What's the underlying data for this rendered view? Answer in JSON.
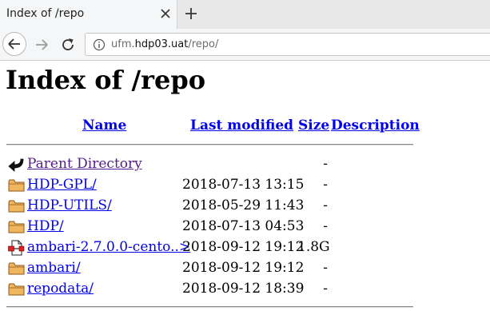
{
  "browser": {
    "tab_title": "Index of /repo",
    "url_prefix": "ufm.",
    "url_host": "hdp03.uat",
    "url_path": "/repo/"
  },
  "page": {
    "title": "Index of /repo",
    "columns": {
      "name": "Name",
      "last_modified": "Last modified",
      "size": "Size",
      "description": "Description"
    },
    "rows": [
      {
        "icon": "back-arrow-icon",
        "name": "Parent Directory",
        "date": "",
        "size": "-",
        "visited": true
      },
      {
        "icon": "folder-icon",
        "name": "HDP-GPL/",
        "date": "2018-07-13 13:15",
        "size": "-"
      },
      {
        "icon": "folder-icon",
        "name": "HDP-UTILS/",
        "date": "2018-05-29 11:43",
        "size": "-"
      },
      {
        "icon": "folder-icon",
        "name": "HDP/",
        "date": "2018-07-13 04:53",
        "size": "-"
      },
      {
        "icon": "archive-file-icon",
        "name": "ambari-2.7.0.0-cento..>",
        "date": "2018-09-12 19:12",
        "size": "1.8G"
      },
      {
        "icon": "folder-icon",
        "name": "ambari/",
        "date": "2018-09-12 19:12",
        "size": "-"
      },
      {
        "icon": "folder-icon",
        "name": "repodata/",
        "date": "2018-09-12 18:39",
        "size": "-"
      }
    ]
  }
}
